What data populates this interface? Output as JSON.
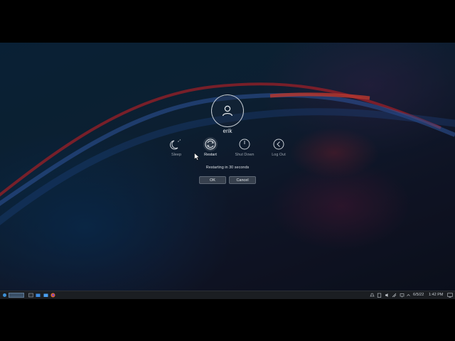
{
  "user": {
    "name": "erik",
    "avatar_icon": "user-icon"
  },
  "actions": [
    {
      "label": "Sleep",
      "icon": "sleep-moon-icon"
    },
    {
      "label": "Restart",
      "icon": "restart-icon",
      "selected": true
    },
    {
      "label": "Shut Down",
      "icon": "power-icon"
    },
    {
      "label": "Log Out",
      "icon": "log-out-arrow-icon"
    }
  ],
  "status": {
    "message": "Restarting in 30 seconds"
  },
  "buttons": {
    "ok": "OK",
    "cancel": "Cancel"
  },
  "taskbar": {
    "date": "6/5/22",
    "time": "1:42 PM",
    "launchers": [
      "app-launcher-icon",
      "pager-icon",
      "terminal-icon",
      "file-manager-icon",
      "firefox-icon"
    ],
    "tray": [
      "notifications-icon",
      "clipboard-icon",
      "volume-icon",
      "network-icon",
      "updates-icon",
      "display-icon"
    ]
  }
}
